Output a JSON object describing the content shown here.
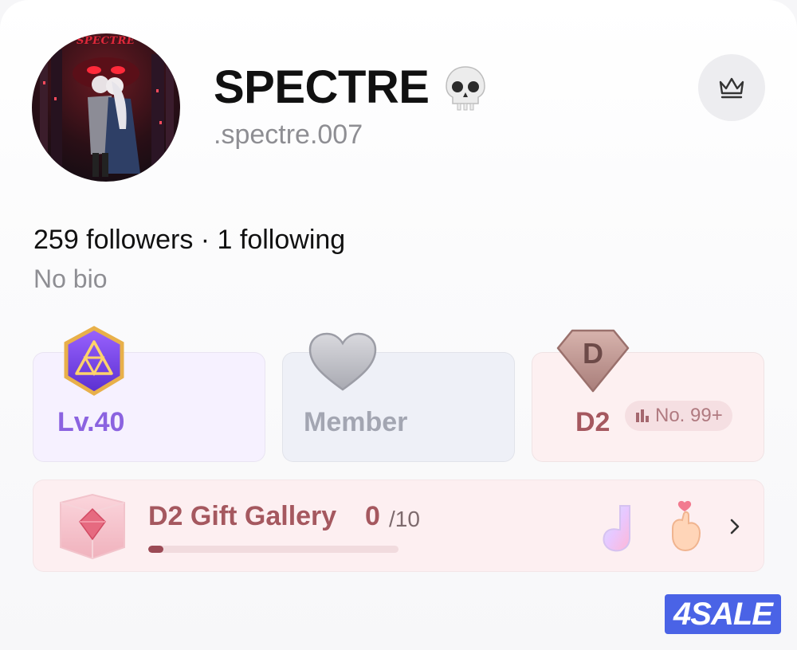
{
  "profile": {
    "display_name": "SPECTRE",
    "handle": ".spectre.007",
    "avatar_text": "SPECTRE",
    "followers": "259 followers · 1 following",
    "bio": "No bio"
  },
  "cards": {
    "level": {
      "label": "Lv.40",
      "icon": "level-hexagon-icon",
      "color": "#8b63e0"
    },
    "membership": {
      "label": "Member",
      "icon": "heart-icon",
      "color": "#a3a6b2"
    },
    "rank": {
      "label": "D2",
      "icon": "diamond-d-icon",
      "rank_badge": "No. 99+",
      "color": "#a5585f"
    }
  },
  "gallery": {
    "title": "D2 Gift Gallery",
    "count": "0",
    "total": "/10",
    "progress": 0.06,
    "icons": [
      "music-note-gift-icon",
      "finger-heart-gift-icon",
      "chevron-right-icon"
    ]
  },
  "watermark": "4SALE"
}
